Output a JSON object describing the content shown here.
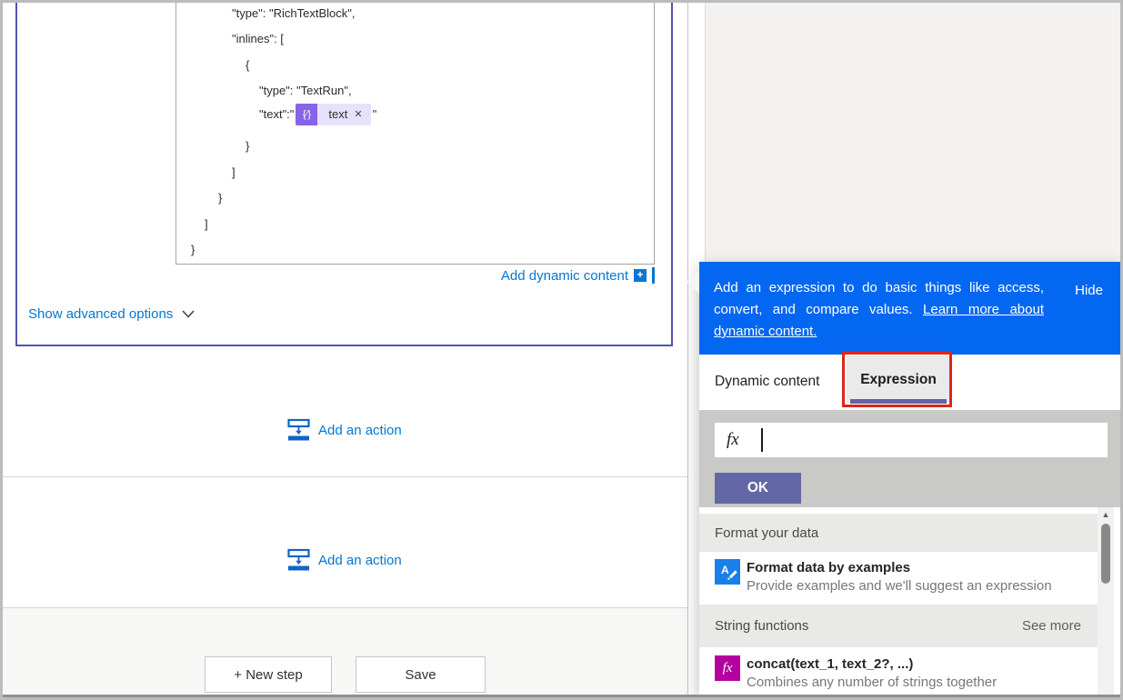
{
  "colors": {
    "banner_blue": "#0467f2",
    "link_blue": "#0078d4",
    "card_border_purple": "#5054b0",
    "ok_purple": "#6467a5",
    "tab_underline_purple": "#6264a7",
    "token_purple": "#8763e6",
    "token_chip_bg": "#e7e2fb",
    "highlight_red": "#de261b",
    "format_icon_blue": "#1a7fe8",
    "function_icon_magenta": "#b4009e"
  },
  "icons": {
    "token_braces": "{⁄}",
    "token_remove": "✕",
    "plus": "+",
    "scroll_up": "▲",
    "fx": "fx",
    "format_letter": "A",
    "format_pencil": "✎"
  },
  "code": {
    "lines": [
      "\"type\": \"RichTextBlock\",",
      "\"inlines\": [",
      "{",
      "\"type\": \"TextRun\",",
      "\"text\":\"",
      "}",
      "]",
      "}",
      "]",
      "}"
    ],
    "token_label": "text",
    "closing_quote": "\""
  },
  "card": {
    "add_dynamic_content": "Add dynamic content",
    "show_advanced_options": "Show advanced options"
  },
  "canvas": {
    "add_action_1": "Add an action",
    "add_action_2": "Add an action"
  },
  "footer": {
    "new_step": "+ New step",
    "save": "Save"
  },
  "panel": {
    "banner": {
      "line1": "Add an expression to do basic things like access,",
      "line2_text": "convert, and compare values. ",
      "line2_link": "Learn more about",
      "line3_link": "dynamic content.",
      "hide": "Hide"
    },
    "tabs": {
      "dynamic_content": "Dynamic content",
      "expression": "Expression"
    },
    "expression_editor": {
      "input_value": "",
      "ok": "OK"
    },
    "sections": [
      {
        "header": "Format your data"
      },
      {
        "header": "String functions",
        "see_more": "See more"
      }
    ],
    "items": [
      {
        "title": "Format data by examples",
        "description": "Provide examples and we'll suggest an expression"
      },
      {
        "title": "concat(text_1, text_2?, ...)",
        "description": "Combines any number of strings together"
      }
    ]
  }
}
